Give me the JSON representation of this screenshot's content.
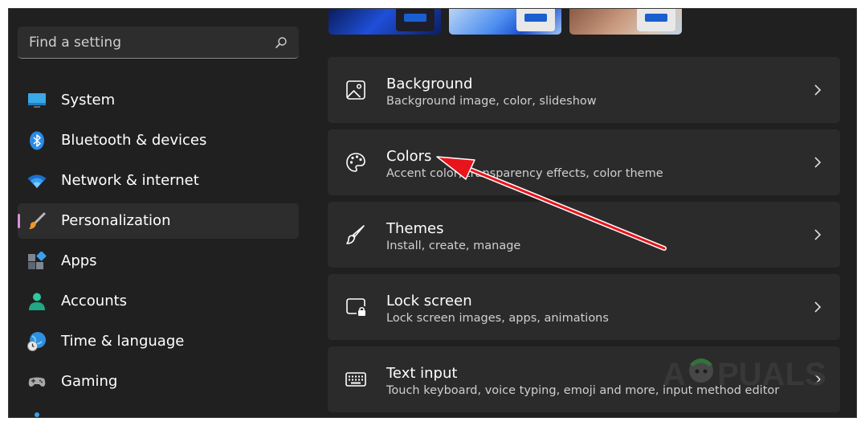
{
  "search": {
    "placeholder": "Find a setting",
    "icon": "search-icon"
  },
  "sidebar": {
    "items": [
      {
        "label": "System",
        "icon": "monitor-icon"
      },
      {
        "label": "Bluetooth & devices",
        "icon": "bluetooth-icon"
      },
      {
        "label": "Network & internet",
        "icon": "wifi-icon"
      },
      {
        "label": "Personalization",
        "icon": "paintbrush-icon",
        "active": true
      },
      {
        "label": "Apps",
        "icon": "apps-icon"
      },
      {
        "label": "Accounts",
        "icon": "person-icon"
      },
      {
        "label": "Time & language",
        "icon": "globe-clock-icon"
      },
      {
        "label": "Gaming",
        "icon": "gamepad-icon"
      }
    ]
  },
  "cards": [
    {
      "title": "Background",
      "subtitle": "Background image, color, slideshow",
      "icon": "image-icon"
    },
    {
      "title": "Colors",
      "subtitle": "Accent color, transparency effects, color theme",
      "icon": "palette-icon"
    },
    {
      "title": "Themes",
      "subtitle": "Install, create, manage",
      "icon": "brush-icon"
    },
    {
      "title": "Lock screen",
      "subtitle": "Lock screen images, apps, animations",
      "icon": "lock-screen-icon"
    },
    {
      "title": "Text input",
      "subtitle": "Touch keyboard, voice typing, emoji and more, input method editor",
      "icon": "keyboard-icon"
    }
  ],
  "colors": {
    "accent": "#d890d8",
    "window_bg": "#202020",
    "card_bg": "#2b2b2b",
    "annotation_arrow": "#e8141c"
  },
  "watermark": {
    "text": "APPUALS"
  }
}
